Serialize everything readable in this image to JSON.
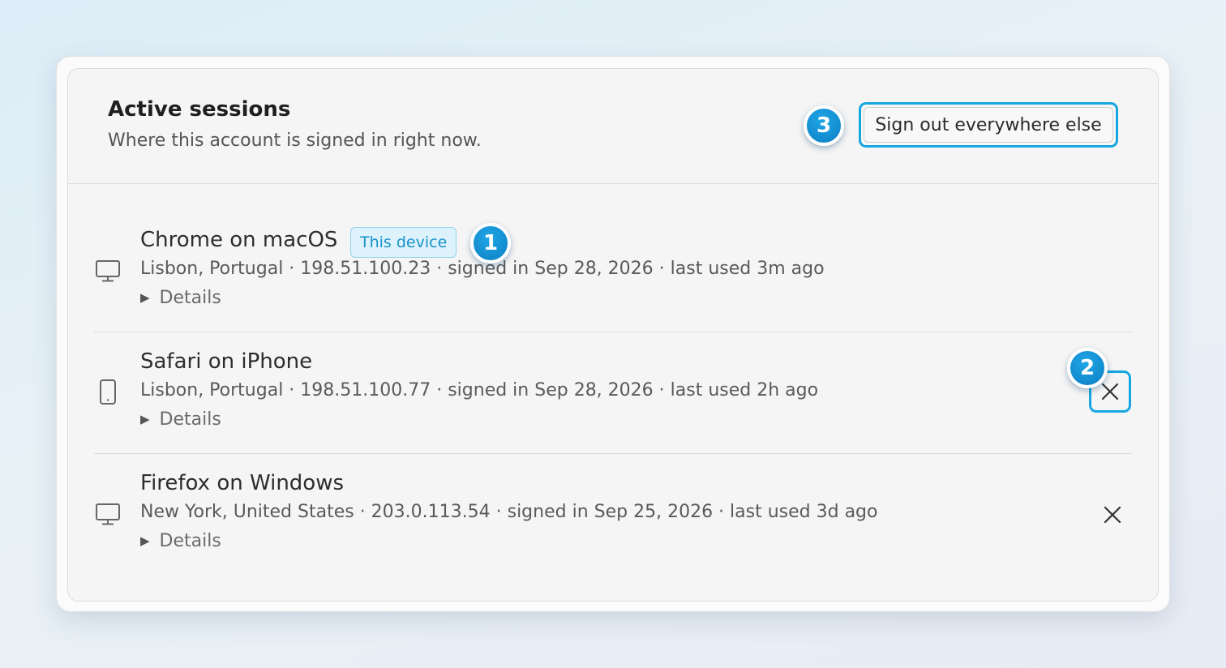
{
  "panel": {
    "title": "Active sessions",
    "subtitle": "Where this account is signed in right now.",
    "signout_all_label": "Sign out everywhere else"
  },
  "sessions": [
    {
      "name": "Chrome on macOS",
      "device_icon": "desktop-icon",
      "badge": "This device",
      "meta": "Lisbon, Portugal · 198.51.100.23 · signed in Sep 28, 2026 · last used 3m ago",
      "details_label": "Details",
      "current": true
    },
    {
      "name": "Safari on iPhone",
      "device_icon": "phone-icon",
      "meta": "Lisbon, Portugal · 198.51.100.77 · signed in Sep 28, 2026 · last used 2h ago",
      "details_label": "Details",
      "current": false
    },
    {
      "name": "Firefox on Windows",
      "device_icon": "desktop-icon",
      "meta": "New York, United States · 203.0.113.54 · signed in Sep 25, 2026 · last used 3d ago",
      "details_label": "Details",
      "current": false
    }
  ],
  "annotations": [
    "1",
    "2",
    "3"
  ],
  "colors": {
    "accent": "#16a6e0",
    "badge_bg": "#def2fb",
    "badge_text": "#1893c9",
    "marker": "#0d8fd3"
  }
}
